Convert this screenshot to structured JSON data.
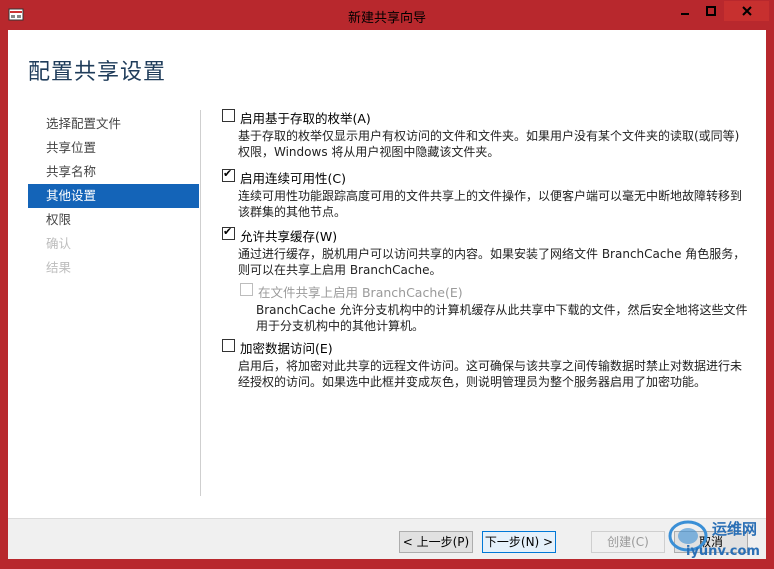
{
  "window": {
    "title": "新建共享向导"
  },
  "page": {
    "heading": "配置共享设置"
  },
  "nav": {
    "items": [
      {
        "label": "选择配置文件",
        "state": "normal"
      },
      {
        "label": "共享位置",
        "state": "normal"
      },
      {
        "label": "共享名称",
        "state": "normal"
      },
      {
        "label": "其他设置",
        "state": "active"
      },
      {
        "label": "权限",
        "state": "normal"
      },
      {
        "label": "确认",
        "state": "disabled"
      },
      {
        "label": "结果",
        "state": "disabled"
      }
    ]
  },
  "options": {
    "access_enum": {
      "label": "启用基于存取的枚举(A)",
      "checked": false,
      "desc_line1": "基于存取的枚举仅显示用户有权访问的文件和文件夹。如果用户没有某个文件夹的读取(或同等)",
      "desc_line2": "权限，Windows 将从用户视图中隐藏该文件夹。"
    },
    "continuous": {
      "label": "启用连续可用性(C)",
      "checked": true,
      "desc_line1": "连续可用性功能跟踪高度可用的文件共享上的文件操作，以便客户端可以毫无中断地故障转移到",
      "desc_line2": "该群集的其他节点。"
    },
    "caching": {
      "label": "允许共享缓存(W)",
      "checked": true,
      "desc_line1": "通过进行缓存，脱机用户可以访问共享的内容。如果安装了网络文件 BranchCache 角色服务，",
      "desc_line2": "则可以在共享上启用 BranchCache。"
    },
    "branchcache": {
      "label": "在文件共享上启用 BranchCache(E)",
      "checked": false,
      "disabled": true,
      "desc_line1": "BranchCache 允许分支机构中的计算机缓存从此共享中下载的文件，然后安全地将这些文件",
      "desc_line2": "用于分支机构中的其他计算机。"
    },
    "encrypt": {
      "label": "加密数据访问(E)",
      "checked": false,
      "desc_line1": "启用后，将加密对此共享的远程文件访问。这可确保与该共享之间传输数据时禁止对数据进行未",
      "desc_line2": "经授权的访问。如果选中此框并变成灰色，则说明管理员为整个服务器启用了加密功能。"
    }
  },
  "buttons": {
    "prev": "< 上一步(P)",
    "next": "下一步(N) >",
    "create": "创建(C)",
    "cancel": "取消"
  },
  "watermark": {
    "text1": "运维网",
    "text2": "iyunv.com"
  },
  "colors": {
    "accent": "#1464b8",
    "titlebar": "#b8282d"
  }
}
